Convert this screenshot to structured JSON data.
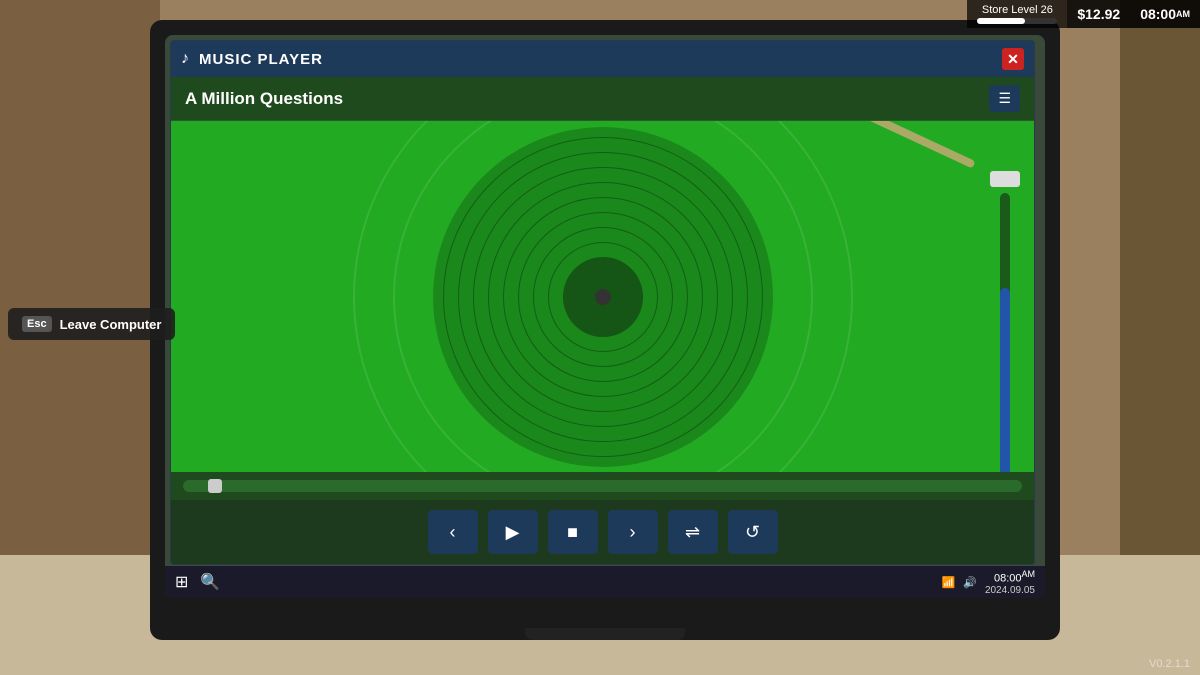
{
  "hud": {
    "store_level_label": "Store Level 26",
    "money": "$12.92",
    "time": "08:00",
    "time_ampm": "AM"
  },
  "leave_computer": {
    "key": "Esc",
    "label": "Leave Computer"
  },
  "music_player": {
    "title": "MUSIC PLAYER",
    "song": "A Million Questions",
    "close_label": "✕",
    "playlist_icon": "☰",
    "controls": {
      "prev": "‹",
      "play": "▶",
      "stop": "■",
      "next": "›",
      "shuffle": "⇌",
      "repeat": "↺"
    },
    "progress_percent": 3,
    "volume_percent": 70
  },
  "taskbar": {
    "time": "08:00",
    "ampm": "AM",
    "date": "2024.09.05",
    "wifi_icon": "wifi",
    "volume_icon": "vol",
    "windows_icon": "⊞",
    "search_icon": "🔍"
  },
  "version": "V0.2.1.1"
}
